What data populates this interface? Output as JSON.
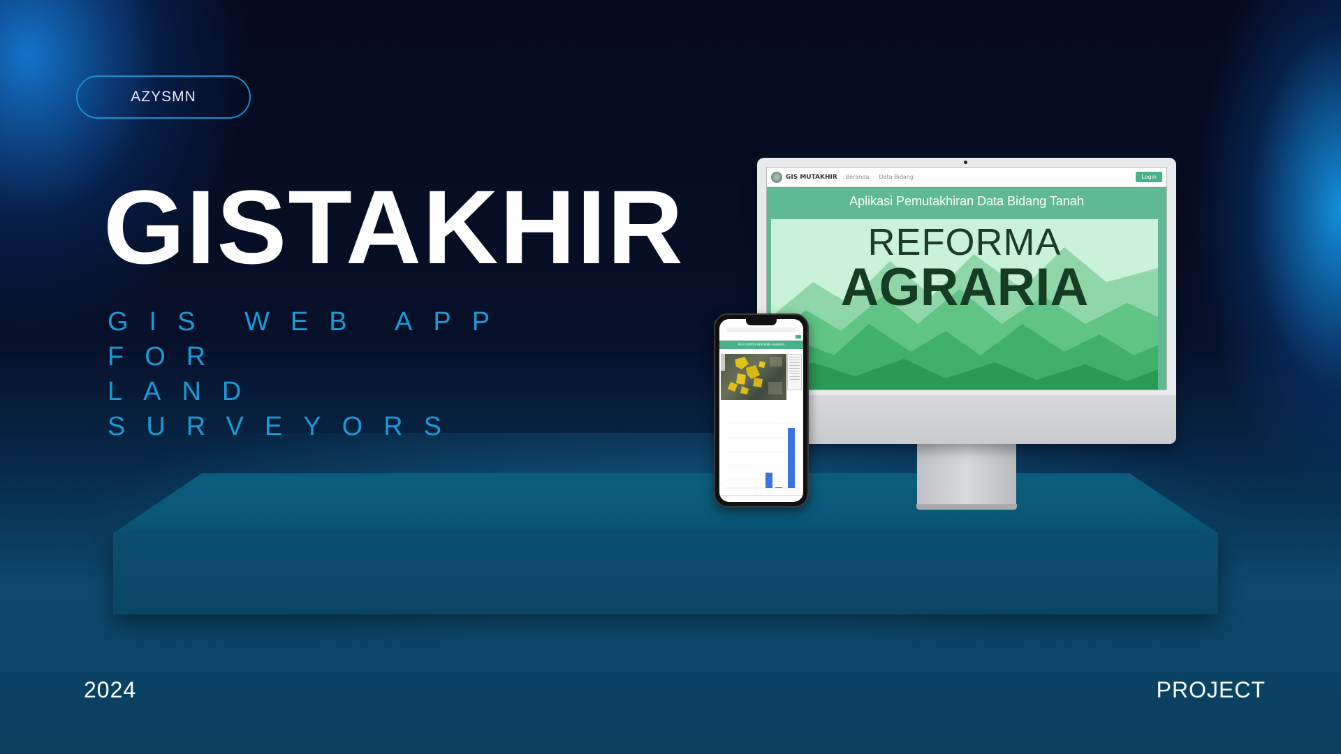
{
  "badge": {
    "label": "AZYSMN"
  },
  "hero": {
    "title": "GISTAKHIR",
    "subtitle_line1": "GIS WEB APP FOR",
    "subtitle_line2": "LAND SURVEYORS"
  },
  "footer": {
    "year": "2024",
    "tag": "PROJECT"
  },
  "monitor_app": {
    "brand": "GIS MUTAKHIR",
    "nav_links": [
      "Beranda",
      "Data Bidang"
    ],
    "login_label": "Login",
    "heading": "Aplikasi Pemutakhiran Data Bidang Tanah",
    "banner_line1": "REFORMA",
    "banner_line2": "AGRARIA"
  },
  "phone_app": {
    "header": "PETA STATUS REFORMA AGRARIA"
  },
  "colors": {
    "background": "#050a1e",
    "accent_blue": "#1a9ad8",
    "app_green": "#47b287",
    "pedestal": "#0b4e6f"
  }
}
